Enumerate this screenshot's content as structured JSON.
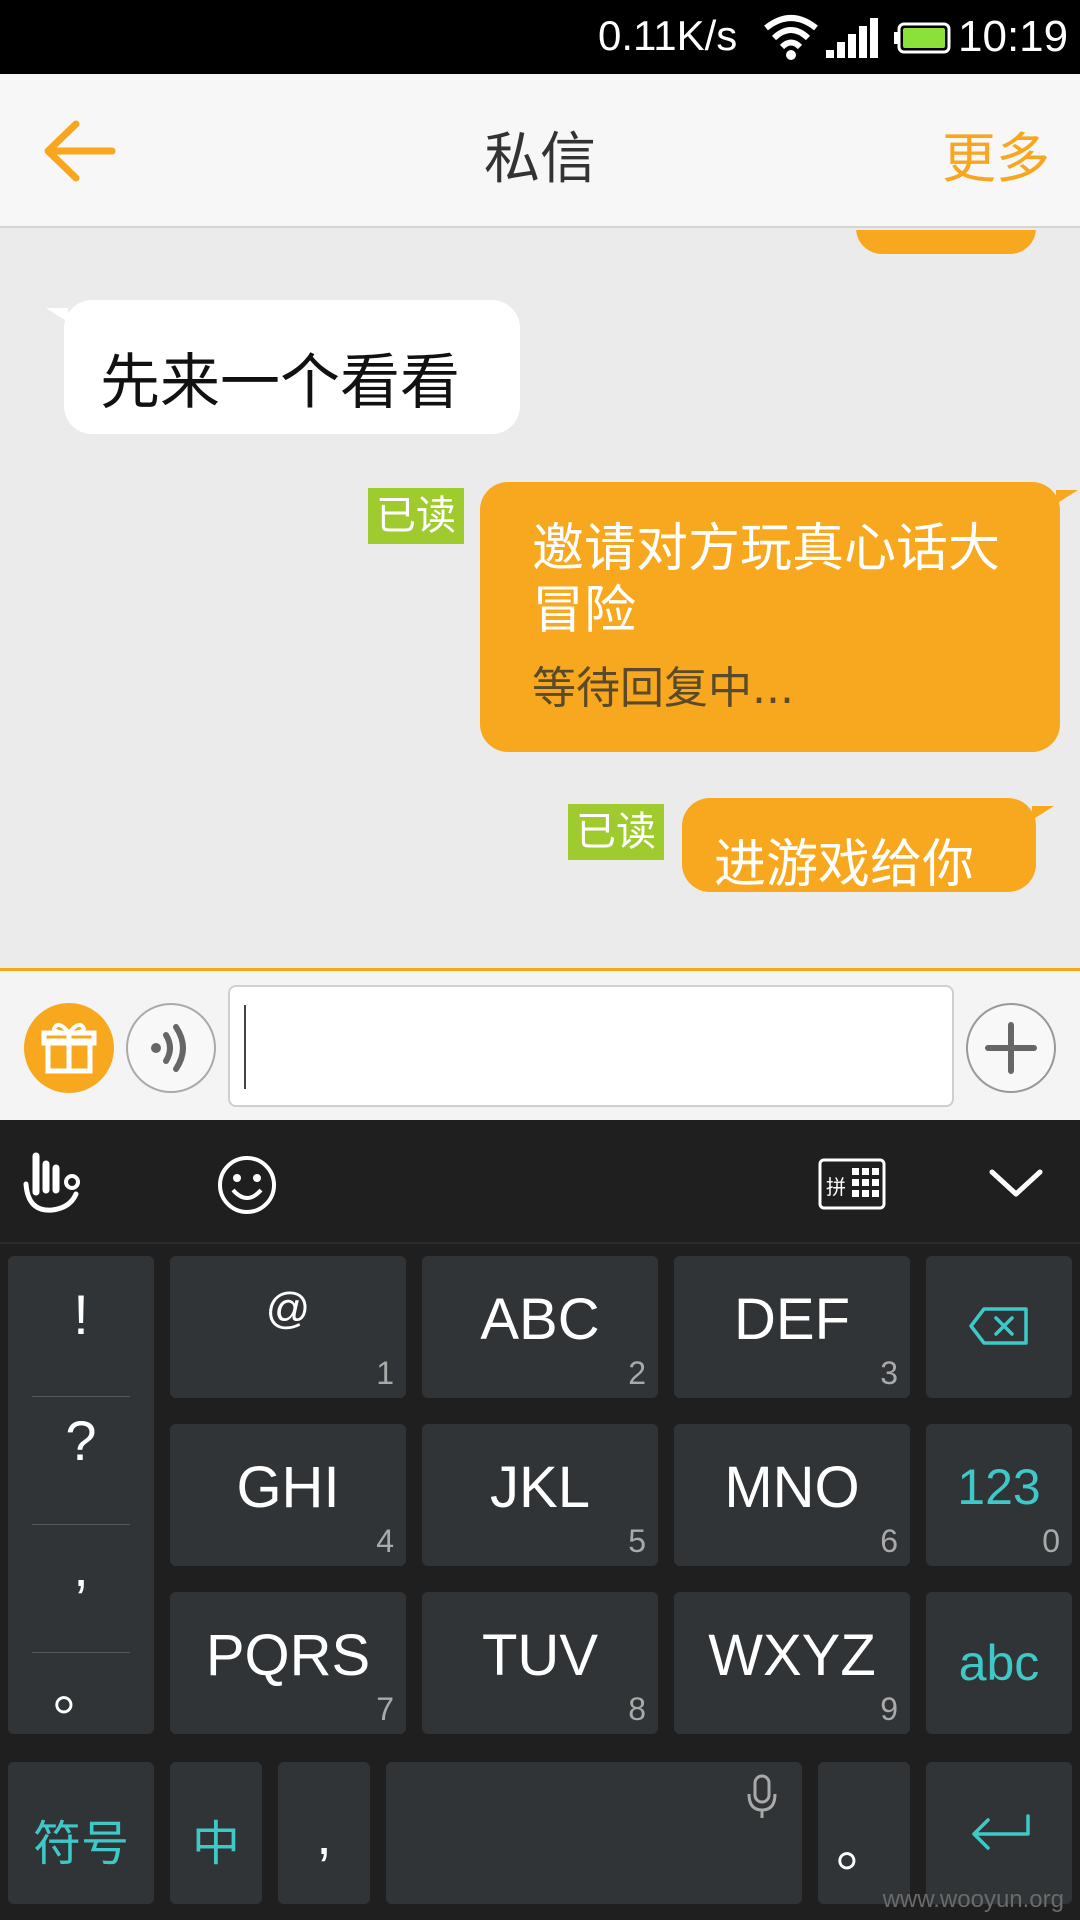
{
  "status_bar": {
    "net_speed": "0.11K/s",
    "time": "10:19",
    "icons": [
      "wifi-icon",
      "signal-icon",
      "battery-icon"
    ],
    "battery_color": "#8be03a"
  },
  "header": {
    "back_icon": "arrow-left-icon",
    "title": "私信",
    "more_label": "更多"
  },
  "colors": {
    "accent": "#f8a81f",
    "read_badge": "#9fcb2f",
    "keyboard_teal": "#3ec8c8"
  },
  "messages": [
    {
      "direction": "incoming",
      "text": "先来一个看看"
    },
    {
      "direction": "outgoing",
      "text": "邀请对方玩真心话大冒险",
      "subtext": "等待回复中...",
      "read_label": "已读"
    },
    {
      "direction": "outgoing",
      "text": "进游戏给你",
      "read_label": "已读"
    }
  ],
  "input_bar": {
    "gift_icon": "gift-icon",
    "voice_icon": "voice-icon",
    "text_value": "",
    "plus_icon": "plus-icon"
  },
  "keyboard": {
    "toolbar_icons": [
      "gesture-icon",
      "emoji-icon",
      "pinyin-keyboard-icon",
      "chevron-down-icon"
    ],
    "punctuation": [
      "!",
      "?",
      ",",
      "。"
    ],
    "rows": [
      [
        {
          "label": "@",
          "num": "1"
        },
        {
          "label": "ABC",
          "num": "2"
        },
        {
          "label": "DEF",
          "num": "3"
        }
      ],
      [
        {
          "label": "GHI",
          "num": "4"
        },
        {
          "label": "JKL",
          "num": "5"
        },
        {
          "label": "MNO",
          "num": "6"
        }
      ],
      [
        {
          "label": "PQRS",
          "num": "7"
        },
        {
          "label": "TUV",
          "num": "8"
        },
        {
          "label": "WXYZ",
          "num": "9"
        }
      ]
    ],
    "right_keys": {
      "backspace_icon": "backspace-icon",
      "num_label": "123",
      "num_sub": "0",
      "abc_label": "abc"
    },
    "bottom_row": {
      "symbols": "符号",
      "chinese": "中",
      "comma": ",",
      "period": "。",
      "mic_icon": "mic-icon",
      "enter_icon": "enter-icon"
    }
  },
  "watermark": "www.wooyun.org"
}
